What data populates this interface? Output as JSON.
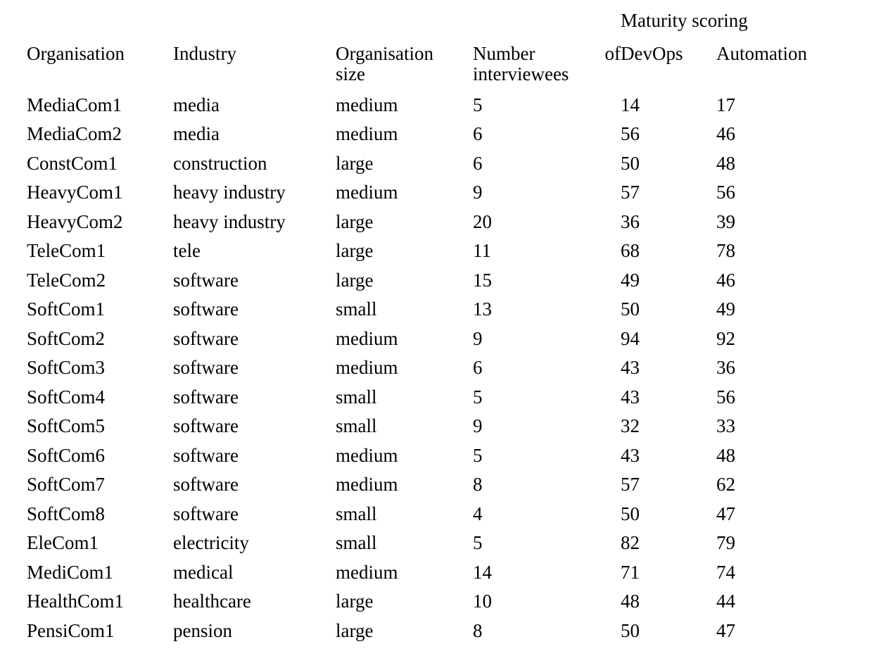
{
  "table": {
    "group_header": {
      "label": "Maturity scoring",
      "spans": [
        "DevOps",
        "Automation"
      ]
    },
    "columns": [
      {
        "key": "organisation",
        "label": "Organisation"
      },
      {
        "key": "industry",
        "label": "Industry"
      },
      {
        "key": "size",
        "label_line1": "Organisation",
        "label_line2": "size"
      },
      {
        "key": "interviewees",
        "label_line1": "Number",
        "label_line1b": "of",
        "label_line2": "interviewees"
      },
      {
        "key": "devops",
        "label": "DevOps"
      },
      {
        "key": "automation",
        "label": "Automation"
      }
    ],
    "rows": [
      {
        "organisation": "MediaCom1",
        "industry": "media",
        "size": "medium",
        "interviewees": "5",
        "devops": "14",
        "automation": "17"
      },
      {
        "organisation": "MediaCom2",
        "industry": "media",
        "size": "medium",
        "interviewees": "6",
        "devops": "56",
        "automation": "46"
      },
      {
        "organisation": "ConstCom1",
        "industry": "construction",
        "size": "large",
        "interviewees": "6",
        "devops": "50",
        "automation": "48"
      },
      {
        "organisation": "HeavyCom1",
        "industry": "heavy industry",
        "size": "medium",
        "interviewees": "9",
        "devops": "57",
        "automation": "56"
      },
      {
        "organisation": "HeavyCom2",
        "industry": "heavy industry",
        "size": "large",
        "interviewees": "20",
        "devops": "36",
        "automation": "39"
      },
      {
        "organisation": "TeleCom1",
        "industry": "tele",
        "size": "large",
        "interviewees": "11",
        "devops": "68",
        "automation": "78"
      },
      {
        "organisation": "TeleCom2",
        "industry": "software",
        "size": "large",
        "interviewees": "15",
        "devops": "49",
        "automation": "46"
      },
      {
        "organisation": "SoftCom1",
        "industry": "software",
        "size": "small",
        "interviewees": "13",
        "devops": "50",
        "automation": "49"
      },
      {
        "organisation": "SoftCom2",
        "industry": "software",
        "size": "medium",
        "interviewees": "9",
        "devops": "94",
        "automation": "92"
      },
      {
        "organisation": "SoftCom3",
        "industry": "software",
        "size": "medium",
        "interviewees": "6",
        "devops": "43",
        "automation": "36"
      },
      {
        "organisation": "SoftCom4",
        "industry": "software",
        "size": "small",
        "interviewees": "5",
        "devops": "43",
        "automation": "56"
      },
      {
        "organisation": "SoftCom5",
        "industry": "software",
        "size": "small",
        "interviewees": "9",
        "devops": "32",
        "automation": "33"
      },
      {
        "organisation": "SoftCom6",
        "industry": "software",
        "size": "medium",
        "interviewees": "5",
        "devops": "43",
        "automation": "48"
      },
      {
        "organisation": "SoftCom7",
        "industry": "software",
        "size": "medium",
        "interviewees": "8",
        "devops": "57",
        "automation": "62"
      },
      {
        "organisation": "SoftCom8",
        "industry": "software",
        "size": "small",
        "interviewees": "4",
        "devops": "50",
        "automation": "47"
      },
      {
        "organisation": "EleCom1",
        "industry": "electricity",
        "size": "small",
        "interviewees": "5",
        "devops": "82",
        "automation": "79"
      },
      {
        "organisation": "MediCom1",
        "industry": "medical",
        "size": "medium",
        "interviewees": "14",
        "devops": "71",
        "automation": "74"
      },
      {
        "organisation": "HealthCom1",
        "industry": "healthcare",
        "size": "large",
        "interviewees": "10",
        "devops": "48",
        "automation": "44"
      },
      {
        "organisation": "PensiCom1",
        "industry": "pension",
        "size": "large",
        "interviewees": "8",
        "devops": "50",
        "automation": "47"
      }
    ]
  }
}
